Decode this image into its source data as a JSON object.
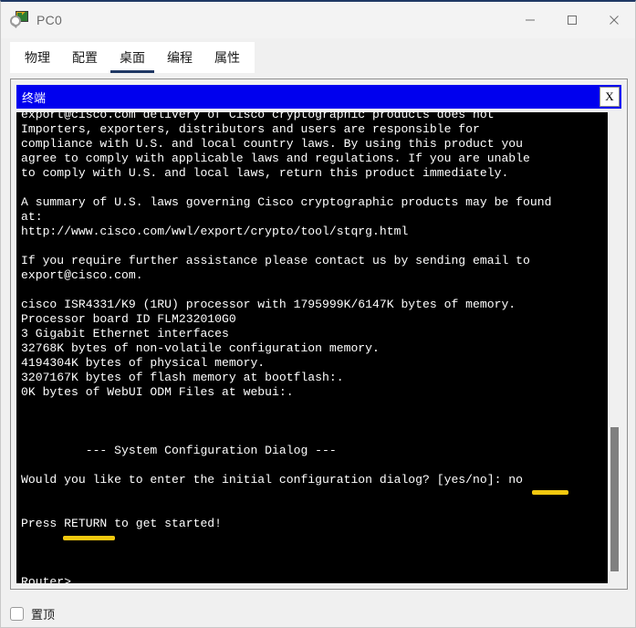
{
  "window": {
    "title": "PC0",
    "icon": "packet-tracer-icon",
    "controls": {
      "minimize": "—",
      "maximize": "□",
      "close": "✕"
    }
  },
  "tabs": [
    {
      "label": "物理",
      "active": false
    },
    {
      "label": "配置",
      "active": false
    },
    {
      "label": "桌面",
      "active": true
    },
    {
      "label": "编程",
      "active": false
    },
    {
      "label": "属性",
      "active": false
    }
  ],
  "terminal": {
    "title": "终端",
    "close_label": "X",
    "accent_color": "#0000ee",
    "background": "#000000",
    "foreground": "#ffffff",
    "highlight_color": "#f2c80f",
    "lines": [
      "export@cisco.com delivery of Cisco cryptographic products does not",
      "Importers, exporters, distributors and users are responsible for",
      "compliance with U.S. and local country laws. By using this product you",
      "agree to comply with applicable laws and regulations. If you are unable",
      "to comply with U.S. and local laws, return this product immediately.",
      "",
      "A summary of U.S. laws governing Cisco cryptographic products may be found",
      "at:",
      "http://www.cisco.com/wwl/export/crypto/tool/stqrg.html",
      "",
      "If you require further assistance please contact us by sending email to",
      "export@cisco.com.",
      "",
      "cisco ISR4331/K9 (1RU) processor with 1795999K/6147K bytes of memory.",
      "Processor board ID FLM232010G0",
      "3 Gigabit Ethernet interfaces",
      "32768K bytes of non-volatile configuration memory.",
      "4194304K bytes of physical memory.",
      "3207167K bytes of flash memory at bootflash:.",
      "0K bytes of WebUI ODM Files at webui:.",
      "",
      "",
      "",
      "         --- System Configuration Dialog ---",
      "",
      "Would you like to enter the initial configuration dialog? [yes/no]: no",
      "",
      "",
      "Press RETURN to get started!",
      "",
      "",
      "",
      "Router>"
    ],
    "highlights": [
      {
        "name": "highlight-no",
        "under_text": "no"
      },
      {
        "name": "highlight-return",
        "under_text": "RETURN"
      }
    ],
    "scrollbar": {
      "position": "near-bottom"
    }
  },
  "footer": {
    "always_on_top_label": "置顶",
    "always_on_top_checked": false
  }
}
